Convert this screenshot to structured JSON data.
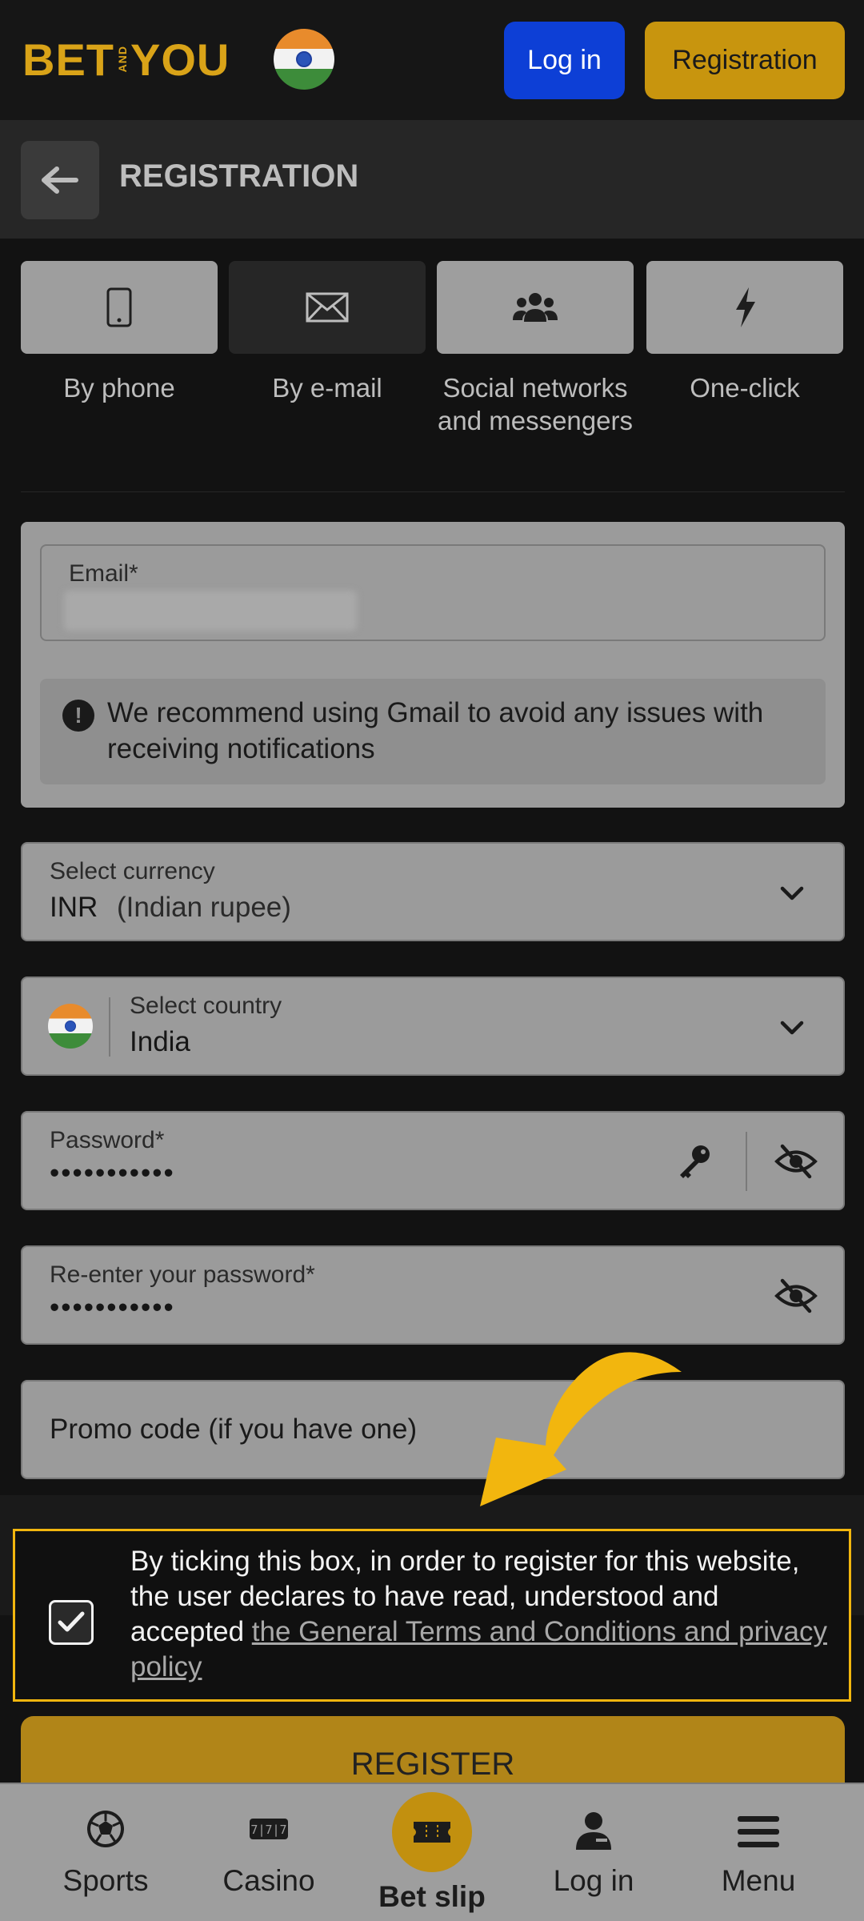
{
  "header": {
    "logo_left": "BET",
    "logo_and": "AND",
    "logo_right": "YOU",
    "login_label": "Log in",
    "register_label": "Registration"
  },
  "titlebar": {
    "title": "REGISTRATION"
  },
  "methods": [
    {
      "label": "By phone",
      "icon": "phone-icon",
      "active": false
    },
    {
      "label": "By e-mail",
      "icon": "envelope-icon",
      "active": true
    },
    {
      "label": "Social networks and messengers",
      "icon": "users-icon",
      "active": false
    },
    {
      "label": "One-click",
      "icon": "lightning-icon",
      "active": false
    }
  ],
  "email": {
    "label": "Email*",
    "notice": "We recommend using Gmail to avoid any issues with receiving notifications"
  },
  "currency": {
    "label": "Select currency",
    "code": "INR",
    "name": "(Indian rupee)"
  },
  "country": {
    "label": "Select country",
    "value": "India"
  },
  "password": {
    "label": "Password*",
    "value": "•••••••••••"
  },
  "confirm_password": {
    "label": "Re-enter your password*",
    "value": "•••••••••••"
  },
  "promo": {
    "placeholder": "Promo code (if you have one)"
  },
  "consent": {
    "checked": true,
    "text": "By ticking this box, in order to register for this website, the user declares to have read, understood and accepted ",
    "link": "the General Terms and Conditions and privacy policy"
  },
  "register_button": "REGISTER",
  "bottom_nav": {
    "sports": "Sports",
    "casino": "Casino",
    "betslip": "Bet slip",
    "login": "Log in",
    "menu": "Menu"
  },
  "colors": {
    "brand_gold": "#d9a318",
    "login_blue": "#0d3fd6",
    "highlight_yellow": "#f2b60e"
  }
}
